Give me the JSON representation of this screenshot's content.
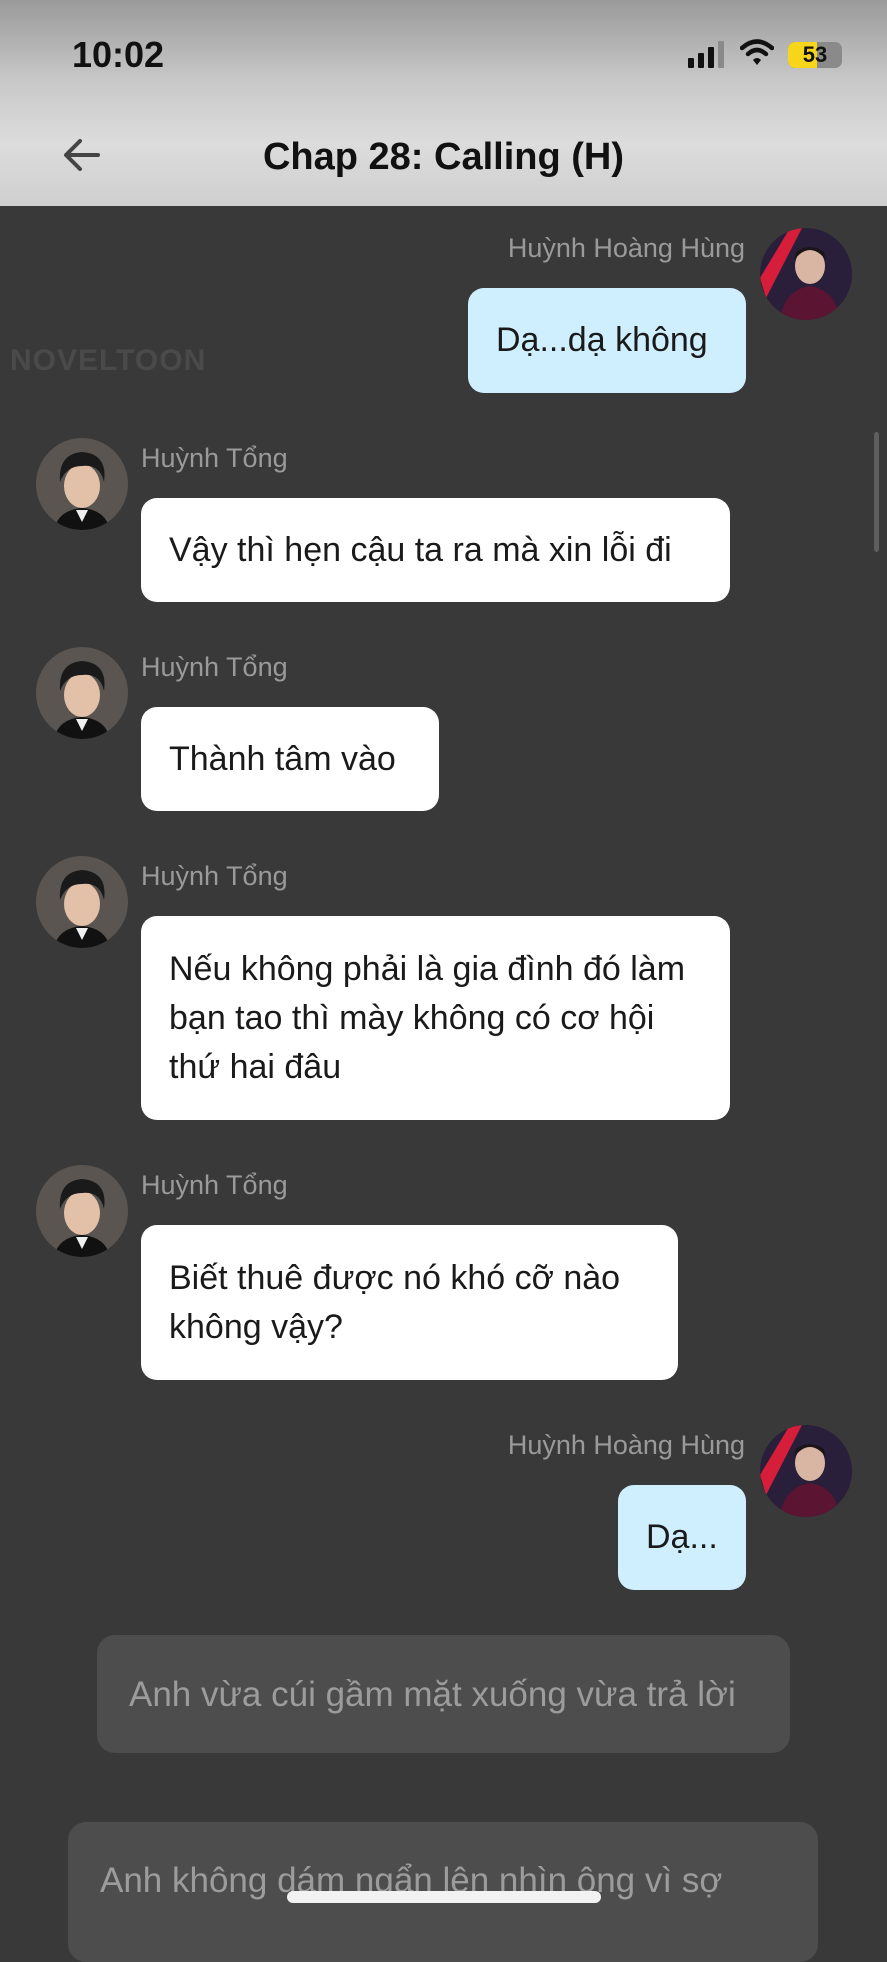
{
  "status_bar": {
    "time": "10:02",
    "battery": "53",
    "battery_level": 0.53
  },
  "header": {
    "title": "Chap 28: Calling (H)"
  },
  "watermark": "NOVELTOON",
  "messages": [
    {
      "sender": "Huỳnh Hoàng Hùng",
      "text": "Dạ...dạ không"
    },
    {
      "sender": "Huỳnh Tổng",
      "text": "Vậy thì hẹn cậu ta ra mà xin lỗi đi"
    },
    {
      "sender": "Huỳnh Tổng",
      "text": "Thành tâm vào"
    },
    {
      "sender": "Huỳnh Tổng",
      "text": "Nếu không phải là gia đình đó làm bạn tao thì mày không có cơ hội thứ hai đâu"
    },
    {
      "sender": "Huỳnh Tổng",
      "text": "Biết thuê được nó khó cỡ nào không vậy?"
    },
    {
      "sender": "Huỳnh Hoàng Hùng",
      "text": "Dạ..."
    }
  ],
  "narrations": [
    {
      "text": "Anh vừa cúi gầm mặt xuống vừa trả lời"
    },
    {
      "text": "Anh không dám ngẩn lên nhìn ông vì sợ"
    }
  ],
  "colors": {
    "bubble_right": "#cfefff",
    "bubble_left": "#ffffff",
    "background": "#393939"
  }
}
